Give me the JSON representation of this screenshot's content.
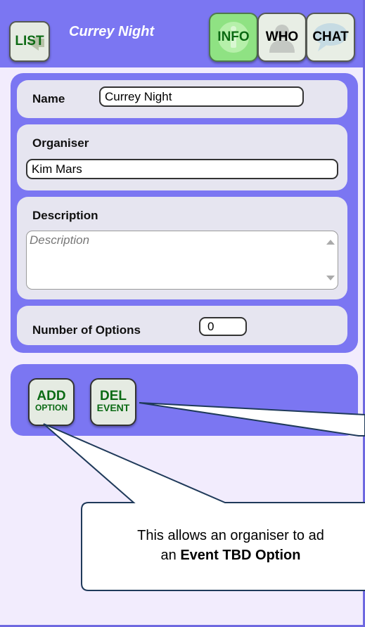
{
  "header": {
    "list_label": "LIST",
    "title": "Currey Night",
    "tabs": [
      {
        "label": "INFO",
        "active": true
      },
      {
        "label": "WHO",
        "active": false
      },
      {
        "label": "CHAT",
        "active": false
      }
    ]
  },
  "form": {
    "name_label": "Name",
    "name_value": "Currey Night",
    "organiser_label": "Organiser",
    "organiser_value": "Kim Mars",
    "description_label": "Description",
    "description_placeholder": "Description",
    "options_label": "Number of Options",
    "options_value": "0"
  },
  "actions": {
    "add_big": "ADD",
    "add_small": "OPTION",
    "del_big": "DEL",
    "del_small": "EVENT"
  },
  "callout": {
    "line1": "This allows an organiser to ad",
    "line2_prefix": "an ",
    "line2_bold": "Event TBD Option"
  },
  "colors": {
    "header_bg": "#7b76f2",
    "panel_bg": "#7b76f2",
    "page_bg": "#f2ecfd",
    "active_tab": "#8fe283",
    "button_text": "#0b6a14"
  }
}
